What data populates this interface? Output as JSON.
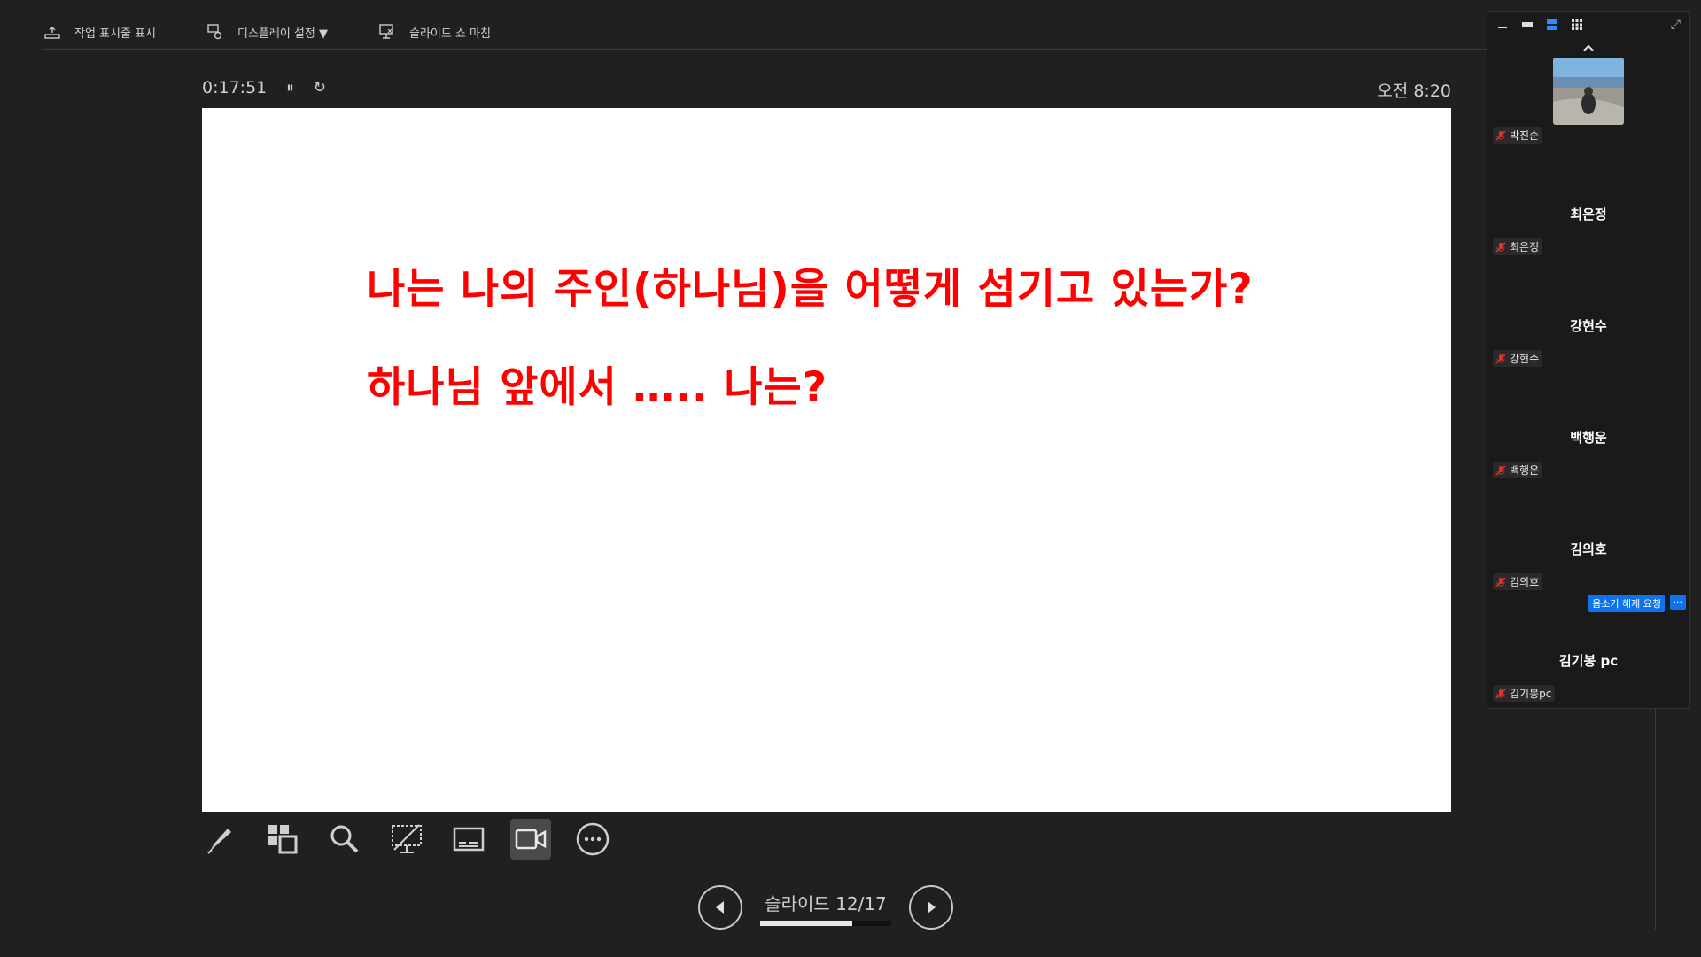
{
  "toolbar": {
    "show_taskbar": "작업 표시줄 표시",
    "display_settings": "디스플레이 설정 ▼",
    "end_slideshow": "슬라이드 쇼 마침"
  },
  "timer": {
    "elapsed": "0:17:51",
    "pause": "⏸",
    "reset": "↻"
  },
  "clock": "오전 8:20",
  "slide": {
    "line1": "나는 나의 주인(하나님)을 어떻게 섬기고 있는가?",
    "line2": "하나님 앞에서 ….. 나는?"
  },
  "tools": [
    "pen-icon",
    "slides-grid-icon",
    "zoom-icon",
    "laser-pointer-icon",
    "subtitles-icon",
    "camera-icon",
    "more-options-icon"
  ],
  "navigation": {
    "label": "슬라이드 12/17",
    "current": 12,
    "total": 17
  },
  "panel": {
    "participants": [
      {
        "display": "",
        "tag": "박진순",
        "has_video": true
      },
      {
        "display": "최은정",
        "tag": "최은정"
      },
      {
        "display": "강현수",
        "tag": "강현수"
      },
      {
        "display": "백행운",
        "tag": "백행운"
      },
      {
        "display": "김의호",
        "tag": "김의호",
        "request": "음소거 해제 요청",
        "more": "···"
      },
      {
        "display": "김기봉 pc",
        "tag": "김기봉pc"
      }
    ]
  },
  "colors": {
    "slide_text": "#ff0000",
    "accent_blue": "#0e72ed",
    "background": "#202020"
  }
}
